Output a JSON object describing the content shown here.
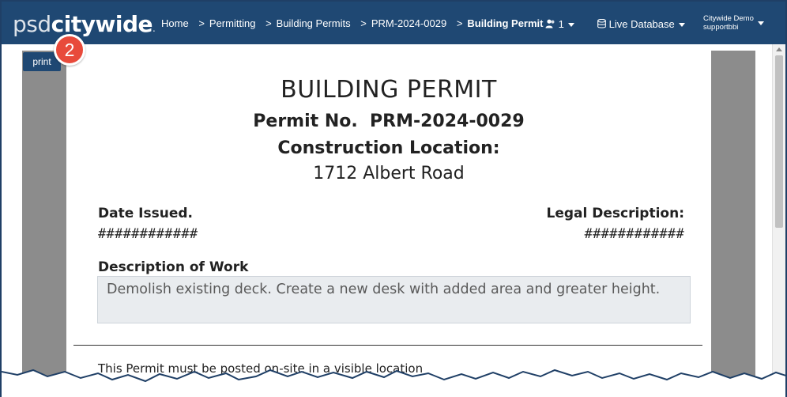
{
  "app": {
    "logo_light": "psd",
    "logo_bold": "citywide",
    "logo_suffix": "."
  },
  "breadcrumb": {
    "items": [
      "Home",
      "Permitting",
      "Building Permits",
      "PRM-2024-0029"
    ],
    "separator": ">",
    "current": "Building Permit"
  },
  "navbar": {
    "user_count": "1",
    "database_label": "Live Database",
    "user_line1": "Citywide Demo",
    "user_line2": "supportbbi"
  },
  "toolbar": {
    "print_label": "print",
    "step_badge": "2"
  },
  "permit": {
    "title": "BUILDING PERMIT",
    "number_label": "Permit No.",
    "number_value": "PRM-2024-0029",
    "location_label": "Construction Location:",
    "location_value": "1712 Albert Road",
    "date_label": "Date Issued.",
    "date_value": "############",
    "legal_label": "Legal Description:",
    "legal_value": "############",
    "work_label": "Description of Work",
    "work_value": "Demolish existing deck. Create a new desk with added area and greater height.",
    "posted_note": "This Permit must be posted on-site in a visible location"
  },
  "colors": {
    "navbar": "#1f4873",
    "badge": "#e84a3b",
    "side_panels": "#8c8c8c"
  }
}
